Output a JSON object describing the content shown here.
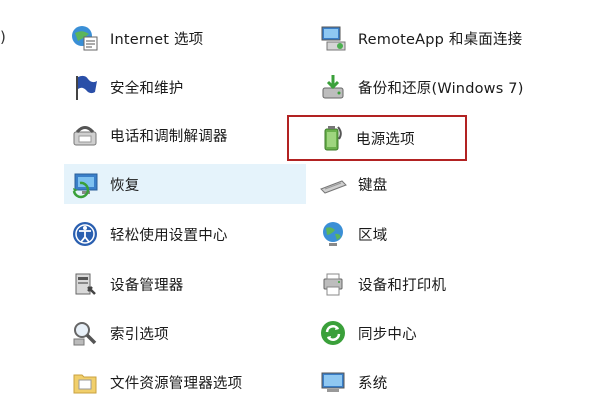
{
  "edge_fragment": ")",
  "items_left": [
    {
      "label": "Internet 选项",
      "icon": "internet-options-icon"
    },
    {
      "label": "安全和维护",
      "icon": "security-flag-icon"
    },
    {
      "label": "电话和调制解调器",
      "icon": "phone-modem-icon"
    },
    {
      "label": "恢复",
      "icon": "recovery-icon"
    },
    {
      "label": "轻松使用设置中心",
      "icon": "ease-of-access-icon"
    },
    {
      "label": "设备管理器",
      "icon": "device-manager-icon"
    },
    {
      "label": "索引选项",
      "icon": "indexing-icon"
    },
    {
      "label": "文件资源管理器选项",
      "icon": "folder-options-icon"
    }
  ],
  "items_right": [
    {
      "label": "RemoteApp 和桌面连接",
      "icon": "remoteapp-icon"
    },
    {
      "label": "备份和还原(Windows 7)",
      "icon": "backup-restore-icon"
    },
    {
      "label": "电源选项",
      "icon": "power-options-icon"
    },
    {
      "label": "键盘",
      "icon": "keyboard-icon"
    },
    {
      "label": "区域",
      "icon": "region-globe-icon"
    },
    {
      "label": "设备和打印机",
      "icon": "devices-printers-icon"
    },
    {
      "label": "同步中心",
      "icon": "sync-center-icon"
    },
    {
      "label": "系统",
      "icon": "system-icon"
    }
  ],
  "selected_item": "恢复",
  "highlighted_item": "电源选项",
  "colors": {
    "selected_bg": "#e5f3fb",
    "highlight_border": "#b22222",
    "text": "#1a1a1a"
  }
}
